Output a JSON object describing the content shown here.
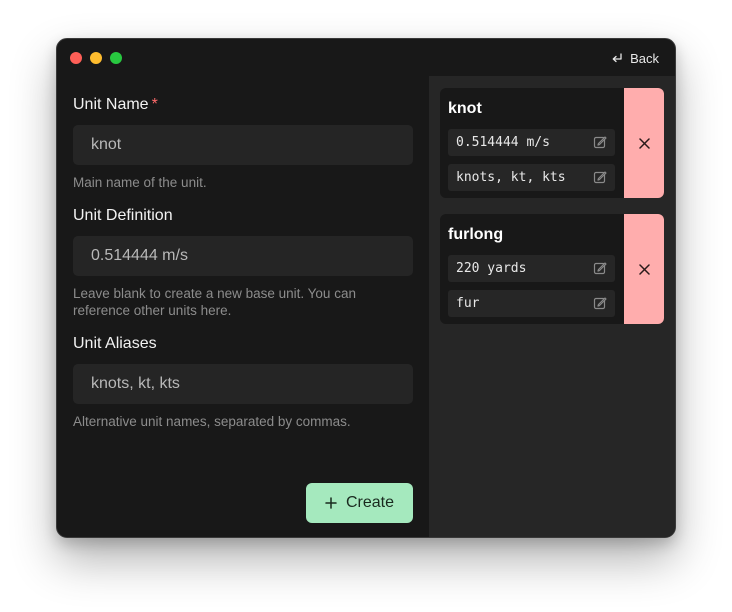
{
  "window": {
    "back_label": "Back"
  },
  "form": {
    "name_label": "Unit Name",
    "name_required_mark": "*",
    "name_value": "knot",
    "name_help": "Main name of the unit.",
    "definition_label": "Unit Definition",
    "definition_value": "0.514444 m/s",
    "definition_help": "Leave blank to create a new base unit. You can reference other units here.",
    "aliases_label": "Unit Aliases",
    "aliases_value": "knots, kt, kts",
    "aliases_help": "Alternative unit names, separated by commas.",
    "create_label": "Create"
  },
  "units": [
    {
      "name": "knot",
      "definition": "0.514444 m/s",
      "aliases": "knots, kt, kts"
    },
    {
      "name": "furlong",
      "definition": "220 yards",
      "aliases": "fur"
    }
  ],
  "colors": {
    "create_button": "#a5e9be",
    "delete_button": "#ffadad",
    "required_mark": "#ff6b6b"
  }
}
